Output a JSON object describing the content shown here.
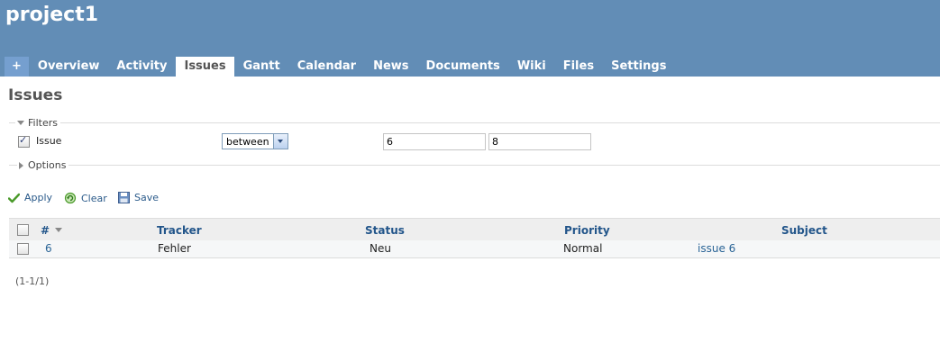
{
  "header": {
    "project_title": "project1",
    "menu": [
      {
        "label": "+",
        "name": "new-object-tab"
      },
      {
        "label": "Overview",
        "name": "tab-overview"
      },
      {
        "label": "Activity",
        "name": "tab-activity"
      },
      {
        "label": "Issues",
        "name": "tab-issues",
        "selected": true
      },
      {
        "label": "Gantt",
        "name": "tab-gantt"
      },
      {
        "label": "Calendar",
        "name": "tab-calendar"
      },
      {
        "label": "News",
        "name": "tab-news"
      },
      {
        "label": "Documents",
        "name": "tab-documents"
      },
      {
        "label": "Wiki",
        "name": "tab-wiki"
      },
      {
        "label": "Files",
        "name": "tab-files"
      },
      {
        "label": "Settings",
        "name": "tab-settings"
      }
    ]
  },
  "page": {
    "title": "Issues"
  },
  "filters": {
    "legend": "Filters",
    "issue_filter": {
      "label": "Issue",
      "checked": true,
      "operator": "between",
      "value_from": "6",
      "value_to": "8"
    }
  },
  "options": {
    "legend": "Options"
  },
  "actions": {
    "apply": "Apply",
    "clear": "Clear",
    "save": "Save"
  },
  "table": {
    "headers": {
      "id": "#",
      "tracker": "Tracker",
      "status": "Status",
      "priority": "Priority",
      "subject": "Subject"
    },
    "rows": [
      {
        "id": "6",
        "tracker": "Fehler",
        "status": "Neu",
        "priority": "Normal",
        "subject": "issue 6"
      }
    ]
  },
  "pagination": "(1-1/1)",
  "colors": {
    "header_bg": "#628db6",
    "link": "#2a6496",
    "apply_icon": "#4a9a2a",
    "clear_icon": "#4a9a2a"
  },
  "icons": {
    "apply": "checkmark-icon",
    "clear": "reload-icon",
    "save": "floppy-disk-icon"
  }
}
